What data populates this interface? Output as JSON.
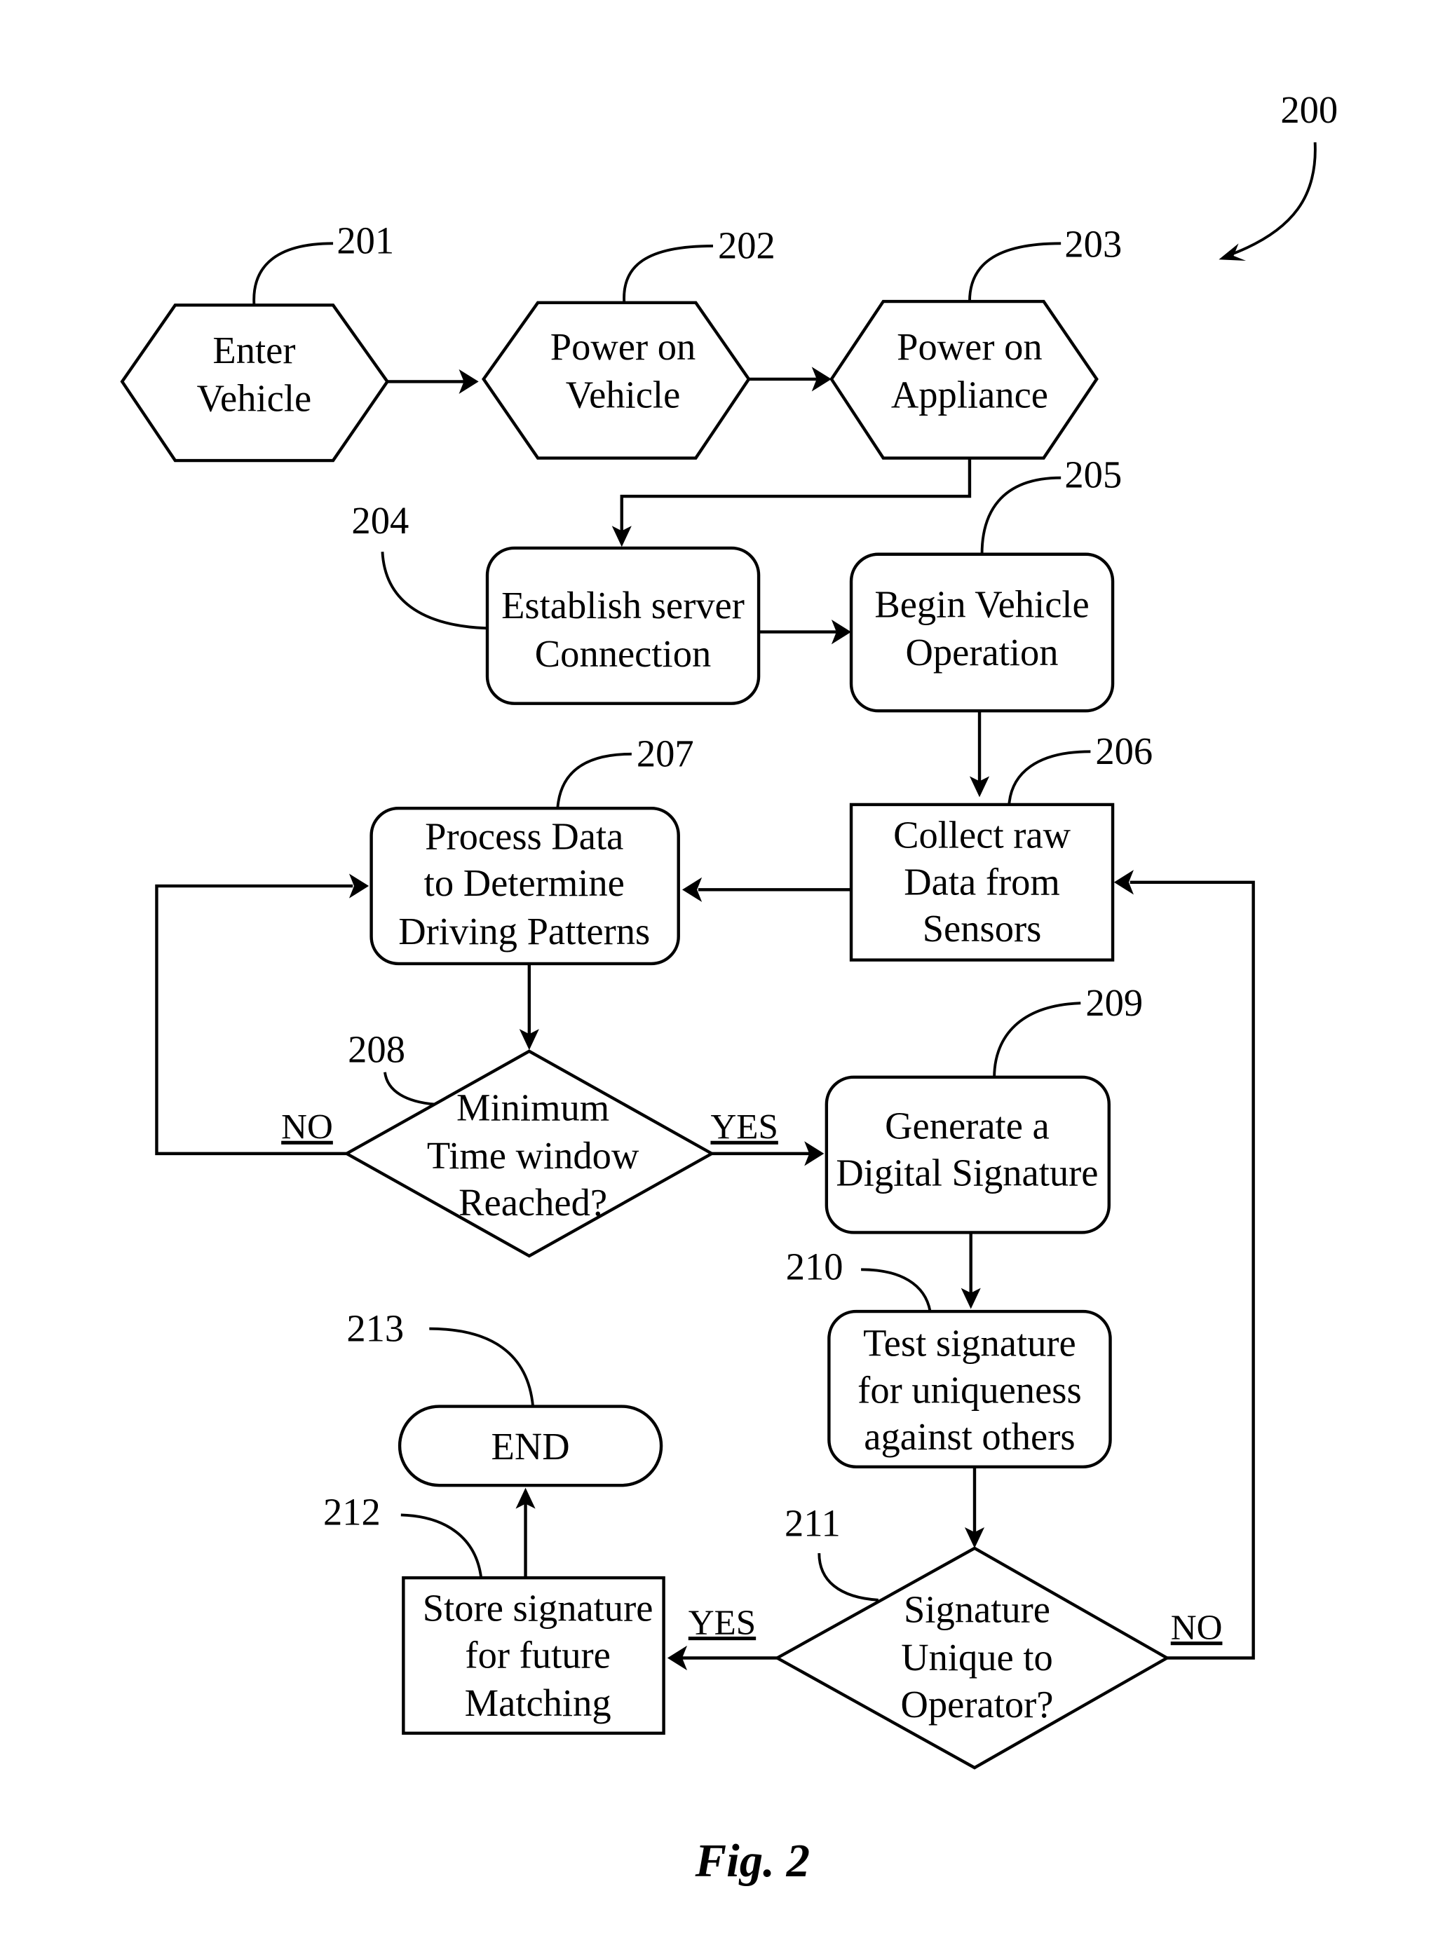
{
  "figure": {
    "reference": "200",
    "caption": "Fig. 2"
  },
  "nodes": {
    "n201": {
      "ref": "201",
      "shape": "hexagon",
      "lines": [
        "Enter",
        "Vehicle"
      ]
    },
    "n202": {
      "ref": "202",
      "shape": "hexagon",
      "lines": [
        "Power on",
        "Vehicle"
      ]
    },
    "n203": {
      "ref": "203",
      "shape": "hexagon",
      "lines": [
        "Power on",
        "Appliance"
      ]
    },
    "n204": {
      "ref": "204",
      "shape": "rounded-rect",
      "lines": [
        "Establish server",
        "Connection"
      ]
    },
    "n205": {
      "ref": "205",
      "shape": "rounded-rect",
      "lines": [
        "Begin Vehicle",
        "Operation"
      ]
    },
    "n206": {
      "ref": "206",
      "shape": "rect",
      "lines": [
        "Collect raw",
        "Data from",
        "Sensors"
      ]
    },
    "n207": {
      "ref": "207",
      "shape": "rounded-rect",
      "lines": [
        "Process Data",
        "to Determine",
        "Driving Patterns"
      ]
    },
    "n208": {
      "ref": "208",
      "shape": "diamond",
      "lines": [
        "Minimum",
        "Time window",
        "Reached?"
      ]
    },
    "n209": {
      "ref": "209",
      "shape": "rounded-rect",
      "lines": [
        "Generate a",
        "Digital Signature"
      ]
    },
    "n210": {
      "ref": "210",
      "shape": "rounded-rect",
      "lines": [
        "Test signature",
        "for uniqueness",
        "against others"
      ]
    },
    "n211": {
      "ref": "211",
      "shape": "diamond",
      "lines": [
        "Signature",
        "Unique to",
        "Operator?"
      ]
    },
    "n212": {
      "ref": "212",
      "shape": "rect",
      "lines": [
        "Store signature",
        "for future",
        "Matching"
      ]
    },
    "n213": {
      "ref": "213",
      "shape": "terminator",
      "lines": [
        "END"
      ]
    }
  },
  "branches": {
    "b208_no": "NO",
    "b208_yes": "YES",
    "b211_yes": "YES",
    "b211_no": "NO"
  },
  "edges": [
    {
      "from": "201",
      "to": "202"
    },
    {
      "from": "202",
      "to": "203"
    },
    {
      "from": "203",
      "to": "204"
    },
    {
      "from": "204",
      "to": "205"
    },
    {
      "from": "205",
      "to": "206"
    },
    {
      "from": "206",
      "to": "207"
    },
    {
      "from": "207",
      "to": "208"
    },
    {
      "from": "208",
      "to": "207",
      "label": "NO"
    },
    {
      "from": "208",
      "to": "209",
      "label": "YES"
    },
    {
      "from": "209",
      "to": "210"
    },
    {
      "from": "210",
      "to": "211"
    },
    {
      "from": "211",
      "to": "212",
      "label": "YES"
    },
    {
      "from": "211",
      "to": "206",
      "label": "NO"
    },
    {
      "from": "212",
      "to": "213"
    }
  ]
}
